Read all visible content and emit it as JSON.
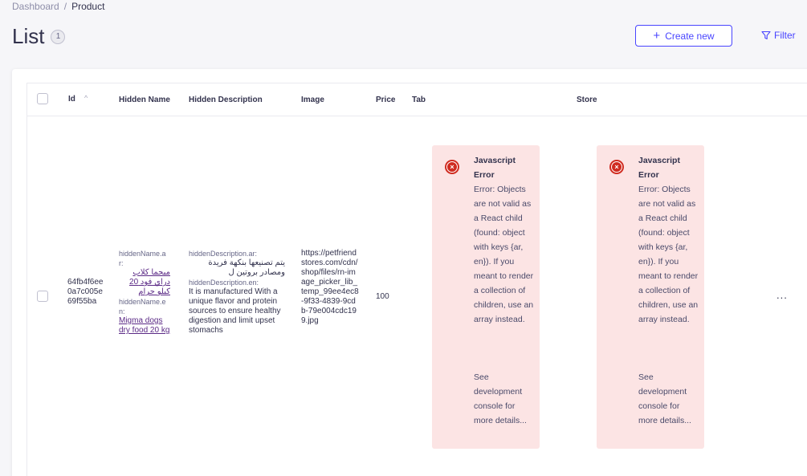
{
  "breadcrumb": {
    "home": "Dashboard",
    "separator": "/",
    "current": "Product"
  },
  "header": {
    "title": "List",
    "count": "1",
    "create_label": "Create new",
    "filter_label": "Filter"
  },
  "table": {
    "columns": {
      "id": "Id",
      "hidden_name": "Hidden Name",
      "hidden_description": "Hidden Description",
      "image": "Image",
      "price": "Price",
      "tab": "Tab",
      "store": "Store"
    },
    "row": {
      "id": "64fb4f6ee0a7c005e69f55ba",
      "hidden_name_ar_label": "hiddenName.ar:",
      "hidden_name_ar_value": "ميجما كلاب دراي فود 20 كيلو جرام",
      "hidden_name_en_label": "hiddenName.en:",
      "hidden_name_en_value": "Migma dogs dry food 20 kg",
      "hidden_desc_ar_label": "hiddenDescription.ar:",
      "hidden_desc_ar_value": "يتم تصنيعها بنكهة فريدة ومصادر بروتين ل",
      "hidden_desc_en_label": "hiddenDescription.en:",
      "hidden_desc_en_value": "It is manufactured With a unique flavor and protein sources to ensure healthy digestion and limit upset stomachs",
      "image": "https://petfriendstores.com/cdn/shop/files/rn-image_picker_lib_temp_99ee4ec8-9f33-4839-9cdb-79e004cdc199.jpg",
      "price": "100",
      "more_label": "..."
    },
    "error": {
      "title": "Javascript Error",
      "message": "Error: Objects are not valid as a React child (found: object with keys {ar, en}). If you meant to render a collection of children, use an array instead.",
      "more": "See development console for more details..."
    }
  }
}
